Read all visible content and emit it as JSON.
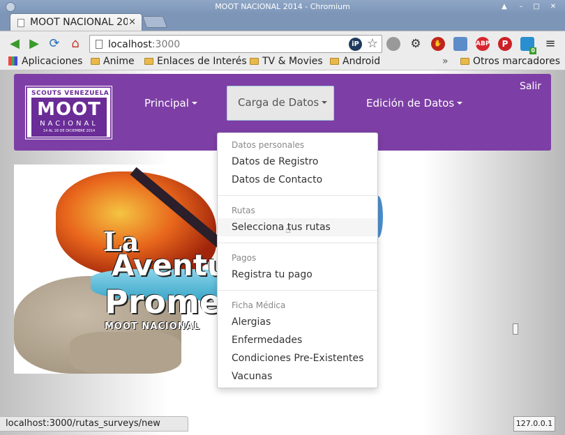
{
  "window": {
    "title": "MOOT NACIONAL 2014 - Chromium"
  },
  "tab": {
    "title": "MOOT NACIONAL 20",
    "close": "×"
  },
  "omnibox": {
    "host": "localhost",
    "port": ":3000",
    "ip_badge": "iP"
  },
  "extensions": {
    "abp": "ABP",
    "badge_count": "0"
  },
  "bookmarks": {
    "apps": "Aplicaciones",
    "items": [
      "Anime",
      "Enlaces de Interés",
      "TV & Movies",
      "Android"
    ],
    "overflow": "»",
    "other": "Otros marcadores"
  },
  "logo": {
    "top": "SCOUTS VENEZUELA",
    "main": "MOOT",
    "sub": "NACIONAL",
    "dates": "14 AL 18 DE DICIEMBRE 2014"
  },
  "navbar": {
    "principal": "Principal",
    "carga": "Carga de Datos",
    "edicion": "Edición de Datos",
    "salir": "Salir"
  },
  "banner": {
    "line1": "La",
    "line2": "Aventu",
    "line3": "Promes",
    "line4": "MOOT NACIONAL"
  },
  "dropdown": {
    "sections": [
      {
        "header": "Datos personales",
        "items": [
          "Datos de Registro",
          "Datos de Contacto"
        ]
      },
      {
        "header": "Rutas",
        "items": [
          "Selecciona tus rutas"
        ]
      },
      {
        "header": "Pagos",
        "items": [
          "Registra tu pago"
        ]
      },
      {
        "header": "Ficha Médica",
        "items": [
          "Alergias",
          "Enfermedades",
          "Condiciones Pre-Existentes",
          "Vacunas"
        ]
      }
    ]
  },
  "status": {
    "url": "localhost:3000/rutas_surveys/new",
    "ip": "127.0.0.1"
  }
}
